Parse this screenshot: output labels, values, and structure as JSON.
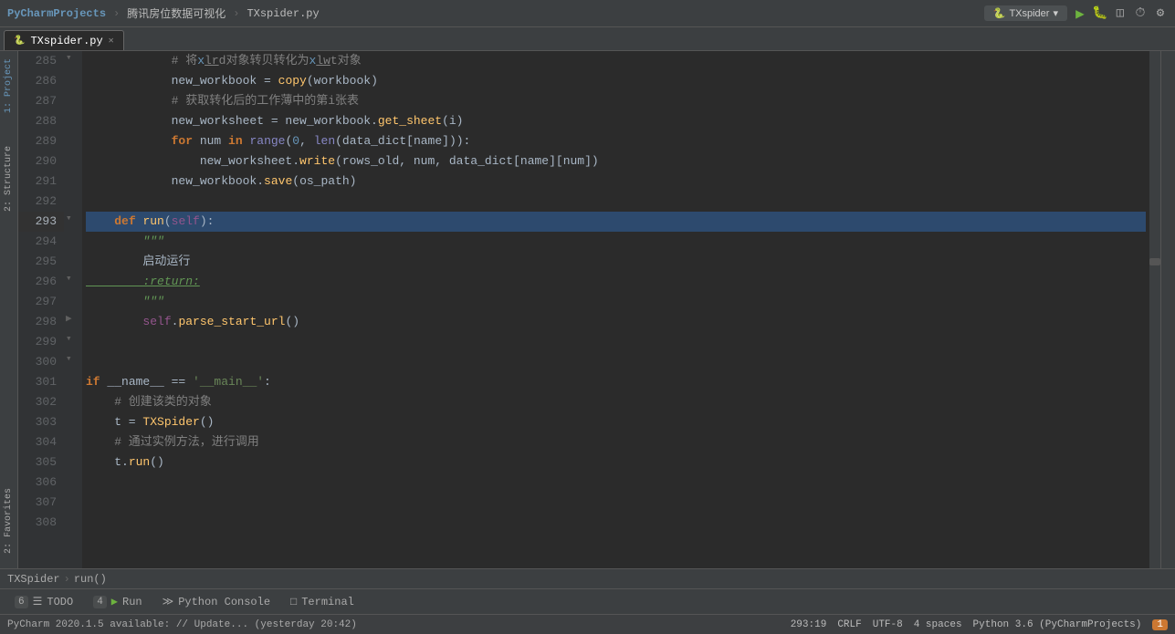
{
  "titlebar": {
    "project": "PyCharmProjects",
    "sep1": "›",
    "folder": "腾讯房位数据可视化",
    "sep2": "›",
    "file": "TXspider.py",
    "run_config": "TXspider",
    "run_label": "Run TXspider"
  },
  "tabs": [
    {
      "id": "txspider",
      "label": "TXspider.py",
      "active": true,
      "icon": "py"
    }
  ],
  "left_sidebar": {
    "items": [
      {
        "id": "project",
        "label": "1: Project"
      },
      {
        "id": "structure",
        "label": "2: Structure"
      },
      {
        "id": "favorites",
        "label": "2: Favorites"
      }
    ]
  },
  "code": {
    "lines": [
      {
        "num": 285,
        "content": "comment_line",
        "raw": "            # 将xlrd对象转贝转化为xlwt对象"
      },
      {
        "num": 286,
        "content": "code",
        "raw": "            new_workbook = copy(workbook)"
      },
      {
        "num": 287,
        "content": "comment_line",
        "raw": "            # 获取转化后的工作薄中的第i张表"
      },
      {
        "num": 288,
        "content": "code",
        "raw": "            new_worksheet = new_workbook.get_sheet(i)"
      },
      {
        "num": 289,
        "content": "for_line",
        "raw": "            for num in range(0, len(data_dict[name])):"
      },
      {
        "num": 290,
        "content": "code",
        "raw": "                new_worksheet.write(rows_old, num, data_dict[name][num])"
      },
      {
        "num": 291,
        "content": "code",
        "raw": "            new_workbook.save(os_path)"
      },
      {
        "num": 292,
        "content": "empty",
        "raw": ""
      },
      {
        "num": 293,
        "content": "def_line",
        "raw": "    def run(self):",
        "active": true
      },
      {
        "num": 294,
        "content": "docstring_start",
        "raw": "        \"\"\""
      },
      {
        "num": 295,
        "content": "docstring_text",
        "raw": "        启动运行"
      },
      {
        "num": 296,
        "content": "docstring_return",
        "raw": "        :return:"
      },
      {
        "num": 297,
        "content": "docstring_end",
        "raw": "        \"\"\""
      },
      {
        "num": 298,
        "content": "code",
        "raw": "        self.parse_start_url()"
      },
      {
        "num": 299,
        "content": "empty",
        "raw": ""
      },
      {
        "num": 300,
        "content": "empty",
        "raw": ""
      },
      {
        "num": 301,
        "content": "if_main",
        "raw": "if __name__ == '__main__':",
        "has_run": true
      },
      {
        "num": 302,
        "content": "comment_line",
        "raw": "    # 创建该类的对象"
      },
      {
        "num": 303,
        "content": "code",
        "raw": "    t = TXSpider()"
      },
      {
        "num": 304,
        "content": "comment_line",
        "raw": "    # 通过实例方法，进行调用"
      },
      {
        "num": 305,
        "content": "code",
        "raw": "    t.run()"
      },
      {
        "num": 306,
        "content": "empty",
        "raw": ""
      },
      {
        "num": 307,
        "content": "empty",
        "raw": ""
      },
      {
        "num": 308,
        "content": "empty",
        "raw": ""
      }
    ]
  },
  "breadcrumb": {
    "class": "TXSpider",
    "method": "run()"
  },
  "bottom_toolbar": {
    "items": [
      {
        "id": "todo",
        "num": "6",
        "label": "TODO",
        "icon": "☰"
      },
      {
        "id": "run",
        "num": "4",
        "label": "Run",
        "icon": "▶"
      },
      {
        "id": "python_console",
        "label": "Python Console",
        "icon": "≫"
      },
      {
        "id": "terminal",
        "label": "Terminal",
        "icon": "□"
      }
    ]
  },
  "statusbar": {
    "left": "PyCharm 2020.1.5 available: // Update... (yesterday 20:42)",
    "position": "293:19",
    "line_ending": "CRLF",
    "encoding": "UTF-8",
    "indent": "4 spaces",
    "python": "Python 3.6 (PyCharmProjects)",
    "notifications": "1"
  }
}
